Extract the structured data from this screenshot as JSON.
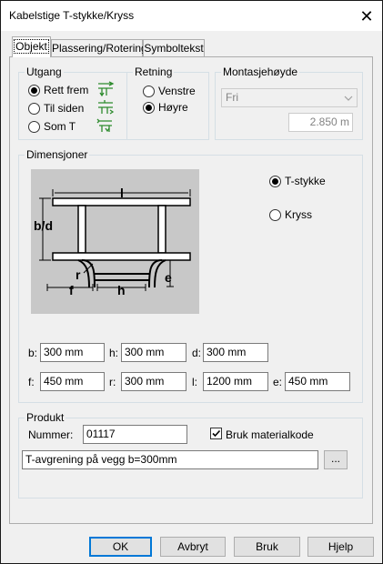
{
  "window": {
    "title": "Kabelstige T-stykke/Kryss",
    "close_glyph": "✕"
  },
  "tabs": [
    {
      "label": "Objekt",
      "active": true
    },
    {
      "label": "Plassering/Rotering",
      "active": false
    },
    {
      "label": "Symboltekst",
      "active": false
    }
  ],
  "utgang": {
    "label": "Utgang",
    "options": [
      {
        "label": "Rett frem",
        "selected": true,
        "icon": "straight-through-icon"
      },
      {
        "label": "Til siden",
        "selected": false,
        "icon": "side-exit-icon"
      },
      {
        "label": "Som T",
        "selected": false,
        "icon": "tee-exit-icon"
      }
    ]
  },
  "retning": {
    "label": "Retning",
    "options": [
      {
        "label": "Venstre",
        "selected": false
      },
      {
        "label": "Høyre",
        "selected": true
      }
    ]
  },
  "montasje": {
    "label": "Montasjehøyde",
    "combo_value": "Fri",
    "height_value": "2.850 m"
  },
  "dimensjoner": {
    "label": "Dimensjoner",
    "diagram_labels": {
      "l": "l",
      "b_d": "b/d",
      "r": "r",
      "e": "e",
      "f": "f",
      "h": "h"
    },
    "type_options": [
      {
        "label": "T-stykke",
        "selected": true
      },
      {
        "label": "Kryss",
        "selected": false
      }
    ],
    "fields": [
      {
        "label": "b:",
        "value": "300 mm"
      },
      {
        "label": "h:",
        "value": "300 mm"
      },
      {
        "label": "d:",
        "value": "300 mm"
      },
      {
        "label": "f:",
        "value": "450 mm"
      },
      {
        "label": "r:",
        "value": "300 mm"
      },
      {
        "label": "l:",
        "value": "1200 mm"
      },
      {
        "label": "e:",
        "value": "450 mm"
      }
    ]
  },
  "produkt": {
    "label": "Produkt",
    "nummer_label": "Nummer:",
    "nummer_value": "01117",
    "checkbox_label": "Bruk materialkode",
    "checkbox_checked": true,
    "description": "T-avgrening på vegg b=300mm",
    "browse_label": "..."
  },
  "buttons": {
    "ok": "OK",
    "cancel": "Avbryt",
    "apply": "Bruk",
    "help": "Hjelp"
  },
  "colors": {
    "accent": "#0078d7",
    "diagram_bg": "#c8c8c8",
    "icon_green": "#2e8b2e"
  }
}
